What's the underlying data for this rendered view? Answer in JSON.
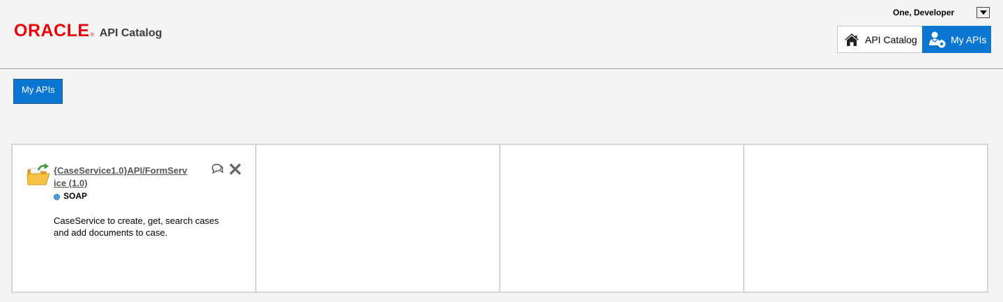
{
  "header": {
    "brand": "ORACLE",
    "brand_mark": "®",
    "product": "API Catalog",
    "user_name": "One, Developer"
  },
  "nav": {
    "home_label": "API Catalog",
    "home_icon": "home-icon",
    "myapis_label": "My APIs",
    "myapis_icon": "user-api-icon",
    "active": "My APIs"
  },
  "tabs": [
    {
      "label": "My APIs",
      "selected": true
    }
  ],
  "apis": [
    {
      "title_line1": "{CaseService1.0}API/FormServ",
      "title_line2": "ice (1.0)",
      "type": "SOAP",
      "description": "CaseService to create, get, search cases and add documents to case.",
      "icon": "api-folder-icon"
    }
  ],
  "colors": {
    "brand_red": "#e8000b",
    "accent_blue": "#0b76d2",
    "status_dot": "#4d9de5"
  }
}
